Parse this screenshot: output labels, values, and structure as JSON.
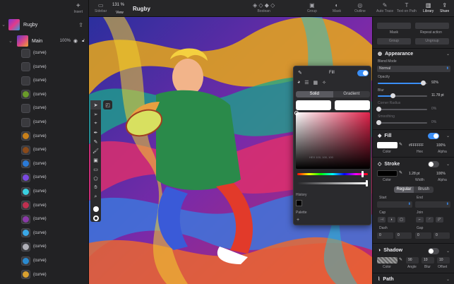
{
  "layers_panel": {
    "insert_label": "Insert",
    "document": {
      "title": "Rugby"
    },
    "main_layer": {
      "title": "Main",
      "opacity": "100%"
    },
    "items": [
      {
        "label": "(curve)",
        "color": "#3a3a3e"
      },
      {
        "label": "(curve)",
        "color": "#3a3a3e"
      },
      {
        "label": "(curve)",
        "color": "#3a3a3e"
      },
      {
        "label": "(curve)",
        "color": "#6a9a2a"
      },
      {
        "label": "(curve)",
        "color": "#3a3a3e"
      },
      {
        "label": "(curve)",
        "color": "#3a3a3e"
      },
      {
        "label": "(curve)",
        "color": "#c8801a"
      },
      {
        "label": "(curve)",
        "color": "#8a4a1a"
      },
      {
        "label": "(curve)",
        "color": "#2a7ad8"
      },
      {
        "label": "(curve)",
        "color": "#7a4ae0"
      },
      {
        "label": "(curve)",
        "color": "#3ad0e0"
      },
      {
        "label": "(curve)",
        "color": "#c03050"
      },
      {
        "label": "(curve)",
        "color": "#8a3aa8"
      },
      {
        "label": "(curve)",
        "color": "#3aa8e8"
      },
      {
        "label": "(curve)",
        "color": "#b0b0b8"
      },
      {
        "label": "(curve)",
        "color": "#2a8ad0"
      },
      {
        "label": "(curve)",
        "color": "#d8a030"
      }
    ]
  },
  "topbar": {
    "sidebar_label": "Sidebar",
    "zoom": "131 %",
    "view_label": "View",
    "title": "Rugby",
    "tools": [
      "Boolean",
      "Group",
      "Mask",
      "Outline",
      "Auto Trace",
      "Text on Path",
      "Library",
      "Share"
    ]
  },
  "toolstrip": {
    "tools": [
      "pointer",
      "direct-select",
      "node",
      "pen",
      "pencil",
      "brush",
      "image",
      "rectangle",
      "shape-builder",
      "hand",
      "zoom"
    ]
  },
  "fill_popover": {
    "title": "Fill",
    "modes": [
      "Solid",
      "Gradient"
    ],
    "active_mode": "Solid",
    "values_hint": "HEX 100, 100, 100",
    "history_label": "History",
    "palette_label": "Palette"
  },
  "inspector": {
    "top_buttons": {
      "mask": "Mask",
      "repeat": "Repeat action",
      "group": "Group",
      "ungroup": "Ungroup"
    },
    "appearance": {
      "title": "Appearance",
      "blend_mode_label": "Blend Mode",
      "blend_mode": "Normal",
      "opacity_label": "Opacity",
      "opacity": "92%",
      "opacity_level": 0.92,
      "blur_label": "Blur",
      "blur": "11.78 pt",
      "blur_level": 0.3,
      "corner_label": "Corner Radius",
      "corner": "0%",
      "smoothing_label": "Smoothing",
      "smoothing": "0%"
    },
    "fill": {
      "title": "Fill",
      "hex": "#FFFFFF",
      "alpha": "100%",
      "color_label": "Color",
      "hex_label": "Hex",
      "alpha_label": "Alpha"
    },
    "stroke": {
      "title": "Stroke",
      "width": "1.28 pt",
      "alpha": "100%",
      "color_label": "Color",
      "width_label": "Width",
      "alpha_label": "Alpha",
      "tabs": [
        "Regular",
        "Brush"
      ],
      "start_label": "Start",
      "end_label": "End",
      "cap_label": "Cap",
      "join_label": "Join",
      "dash_label": "Dash",
      "gap_label": "Gap",
      "dash": "0",
      "dash2": "0",
      "gap": "0",
      "gap2": "0"
    },
    "shadow": {
      "title": "Shadow",
      "angle": "90",
      "blur": "10",
      "offset": "10",
      "color_label": "Color",
      "angle_label": "Angle",
      "blur_label": "Blur",
      "offset_label": "Offset"
    },
    "path": {
      "title": "Path"
    }
  }
}
